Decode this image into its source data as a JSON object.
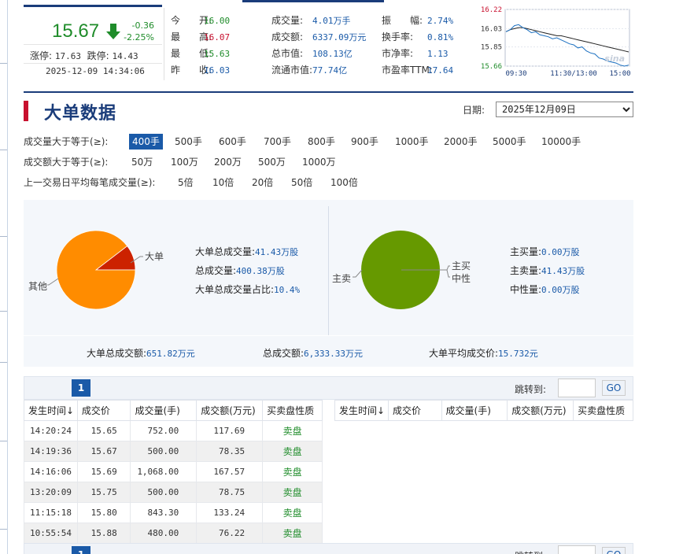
{
  "quote": {
    "price": "15.67",
    "change": "-0.36",
    "change_pct": "-2.25%",
    "limit_up_label": "涨停:",
    "limit_up": "17.63",
    "limit_down_label": "跌停:",
    "limit_down": "14.43",
    "time": "2025-12-09 14:34:06",
    "rows": [
      [
        {
          "label": "今　　开:",
          "value": "16.00",
          "color": "#1f8c2a"
        },
        {
          "label": "成交量:",
          "value": "4.01万手",
          "color": "#1a5aa8"
        },
        {
          "label": "振　　幅:",
          "value": "2.74%",
          "color": "#1a5aa8"
        }
      ],
      [
        {
          "label": "最　　高:",
          "value": "16.07",
          "color": "#c8102e"
        },
        {
          "label": "成交额:",
          "value": "6337.09万元",
          "color": "#1a5aa8"
        },
        {
          "label": "换手率:",
          "value": "0.81%",
          "color": "#1a5aa8"
        }
      ],
      [
        {
          "label": "最　　低:",
          "value": "15.63",
          "color": "#1f8c2a"
        },
        {
          "label": "总市值:",
          "value": "108.13亿",
          "color": "#1a5aa8"
        },
        {
          "label": "市净率:",
          "value": "1.13",
          "color": "#1a5aa8"
        }
      ],
      [
        {
          "label": "昨　　收:",
          "value": "16.03",
          "color": "#1a5aa8"
        },
        {
          "label": "流通市值:",
          "value": "77.74亿",
          "color": "#1a5aa8"
        },
        {
          "label": "市盈率TTM:",
          "value": "17.64",
          "color": "#1a5aa8"
        }
      ]
    ],
    "colors": {
      "down": "#1f8c2a",
      "up": "#c8102e",
      "link": "#1a5aa8"
    }
  },
  "mini_chart": {
    "y_ticks": [
      "16.22",
      "16.03",
      "15.85",
      "15.66"
    ],
    "y_tick_values": [
      16.22,
      16.03,
      15.85,
      15.66
    ],
    "x_ticks": [
      "09:30",
      "11:30/13:00",
      "15:00"
    ],
    "watermark": "sina",
    "price_series": [
      16.0,
      16.02,
      16.06,
      16.07,
      16.04,
      16.02,
      15.99,
      16.0,
      15.97,
      15.96,
      15.95,
      15.93,
      15.94,
      15.92,
      15.9,
      15.88,
      15.87,
      15.84,
      15.85,
      15.81,
      15.79,
      15.78,
      15.74,
      15.73,
      15.71,
      15.7,
      15.69,
      15.67,
      15.66,
      15.67
    ],
    "avg_series": [
      16.0,
      16.02,
      16.03,
      16.04,
      16.04,
      16.03,
      16.02,
      16.01,
      16.0,
      15.99,
      15.98,
      15.97,
      15.96,
      15.96,
      15.95,
      15.94,
      15.93,
      15.92,
      15.91,
      15.9,
      15.89,
      15.88,
      15.87,
      15.86,
      15.85,
      15.84,
      15.83,
      15.82,
      15.81,
      15.8
    ]
  },
  "section": {
    "title": "大单数据",
    "date_label": "日期:",
    "date_value": "2025年12月09日"
  },
  "filters": {
    "volume": {
      "label": "成交量大于等于(≥):",
      "options": [
        "400手",
        "500手",
        "600手",
        "700手",
        "800手",
        "900手",
        "1000手",
        "2000手",
        "5000手",
        "10000手"
      ]
    },
    "amount": {
      "label": "成交额大于等于(≥):",
      "options": [
        "50万",
        "100万",
        "200万",
        "500万",
        "1000万"
      ]
    },
    "ratio": {
      "label": "上一交易日平均每笔成交量(≥):",
      "options": [
        "5倍",
        "10倍",
        "20倍",
        "50倍",
        "100倍"
      ]
    }
  },
  "stats": {
    "pie1": {
      "slices": [
        {
          "label": "大单",
          "value": 10.4,
          "color": "#cc2200"
        },
        {
          "label": "其他",
          "value": 89.6,
          "color": "#ff8c00"
        }
      ]
    },
    "pie2": {
      "slices": [
        {
          "label": "主买",
          "value": 0,
          "color": "#669900"
        },
        {
          "label": "中性",
          "value": 0,
          "color": "#669900"
        },
        {
          "label": "主卖",
          "value": 100,
          "color": "#669900"
        }
      ]
    },
    "left": [
      {
        "label": "大单总成交量:",
        "value": "41.43万股"
      },
      {
        "label": "总成交量:",
        "value": "400.38万股"
      },
      {
        "label": "大单总成交量占比:",
        "value": "10.4%"
      }
    ],
    "right": [
      {
        "label": "主买量:",
        "value": "0.00万股"
      },
      {
        "label": "主卖量:",
        "value": "41.43万股"
      },
      {
        "label": "中性量:",
        "value": "0.00万股"
      }
    ],
    "bottom": [
      {
        "label": "大单总成交额:",
        "value": "651.82万元"
      },
      {
        "label": "总成交额:",
        "value": "6,333.33万元"
      },
      {
        "label": "大单平均成交价:",
        "value": "15.732元"
      }
    ]
  },
  "pager": {
    "page": "1",
    "jump_label": "跳转到:",
    "go_label": "GO"
  },
  "table": {
    "headers": [
      "发生时间↓",
      "成交价",
      "成交量(手)",
      "成交额(万元)",
      "买卖盘性质"
    ],
    "rows": [
      [
        "14:20:24",
        "15.65",
        "752.00",
        "117.69",
        "卖盘"
      ],
      [
        "14:19:36",
        "15.67",
        "500.00",
        "78.35",
        "卖盘"
      ],
      [
        "14:16:06",
        "15.69",
        "1,068.00",
        "167.57",
        "卖盘"
      ],
      [
        "13:20:09",
        "15.75",
        "500.00",
        "78.75",
        "卖盘"
      ],
      [
        "11:15:18",
        "15.80",
        "843.30",
        "133.24",
        "卖盘"
      ],
      [
        "10:55:54",
        "15.88",
        "480.00",
        "76.22",
        "卖盘"
      ]
    ]
  }
}
